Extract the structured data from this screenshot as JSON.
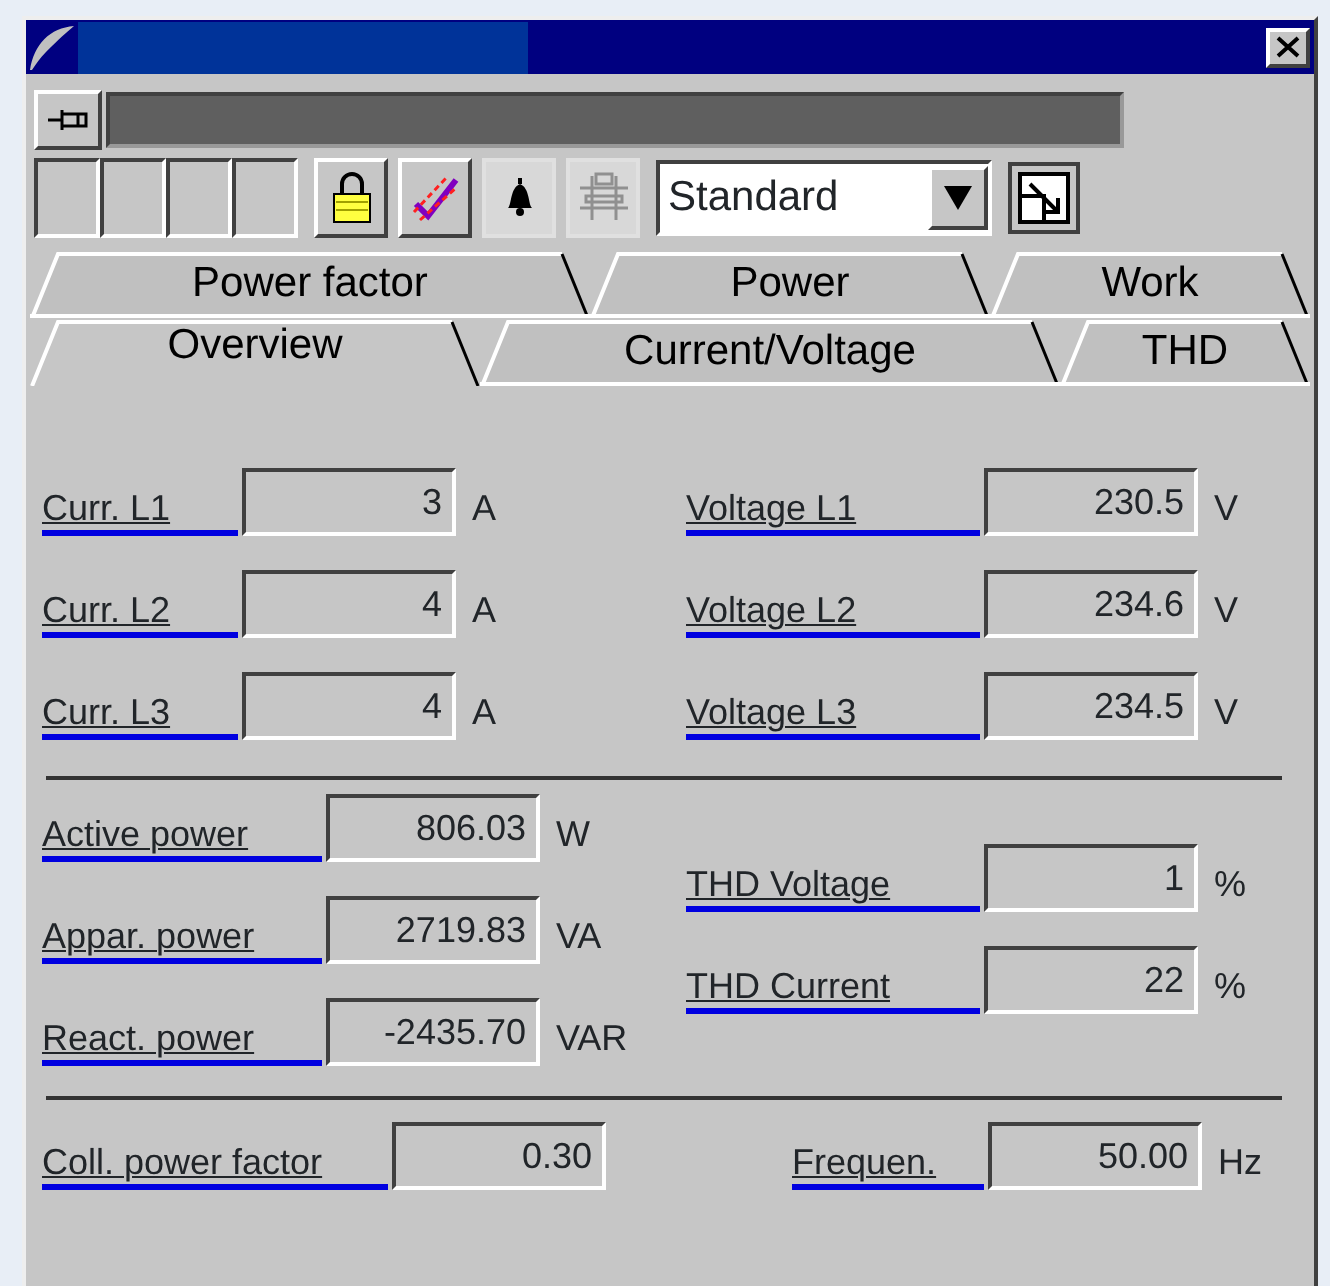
{
  "toolbar": [
    {
      "kind": "blank",
      "disabled": false
    },
    {
      "kind": "blank",
      "disabled": false
    },
    {
      "kind": "blank",
      "disabled": false
    },
    {
      "kind": "blank",
      "disabled": false
    },
    {
      "kind": "lock",
      "disabled": false
    },
    {
      "kind": "check",
      "disabled": false
    },
    {
      "kind": "bell",
      "disabled": false
    },
    {
      "kind": "filter",
      "disabled": true
    }
  ],
  "view_select": {
    "value": "Standard"
  },
  "tab_rows": [
    [
      {
        "label": "Power factor",
        "selected": false
      },
      {
        "label": "Power",
        "selected": false
      },
      {
        "label": "Work",
        "selected": false
      }
    ],
    [
      {
        "label": "Overview",
        "selected": true
      },
      {
        "label": "Current/Voltage",
        "selected": false
      },
      {
        "label": "THD",
        "selected": false
      }
    ]
  ],
  "currents": [
    {
      "label": "Curr. L1",
      "value": "3",
      "unit": "A"
    },
    {
      "label": "Curr. L2",
      "value": "4",
      "unit": "A"
    },
    {
      "label": "Curr. L3",
      "value": "4",
      "unit": "A"
    }
  ],
  "voltages": [
    {
      "label": "Voltage L1",
      "value": "230.5",
      "unit": "V"
    },
    {
      "label": "Voltage L2",
      "value": "234.6",
      "unit": "V"
    },
    {
      "label": "Voltage L3",
      "value": "234.5",
      "unit": "V"
    }
  ],
  "powers": [
    {
      "label": "Active power",
      "value": "806.03",
      "unit": "W"
    },
    {
      "label": "Appar. power",
      "value": "2719.83",
      "unit": "VA"
    },
    {
      "label": "React. power",
      "value": "-2435.70",
      "unit": "VAR"
    }
  ],
  "thd": [
    {
      "label": "THD Voltage",
      "value": "1",
      "unit": "%"
    },
    {
      "label": "THD Current",
      "value": "22",
      "unit": "%"
    }
  ],
  "power_factor": {
    "label": "Coll. power factor",
    "value": "0.30"
  },
  "frequency": {
    "label": "Frequen.",
    "value": "50.00",
    "unit": "Hz"
  }
}
